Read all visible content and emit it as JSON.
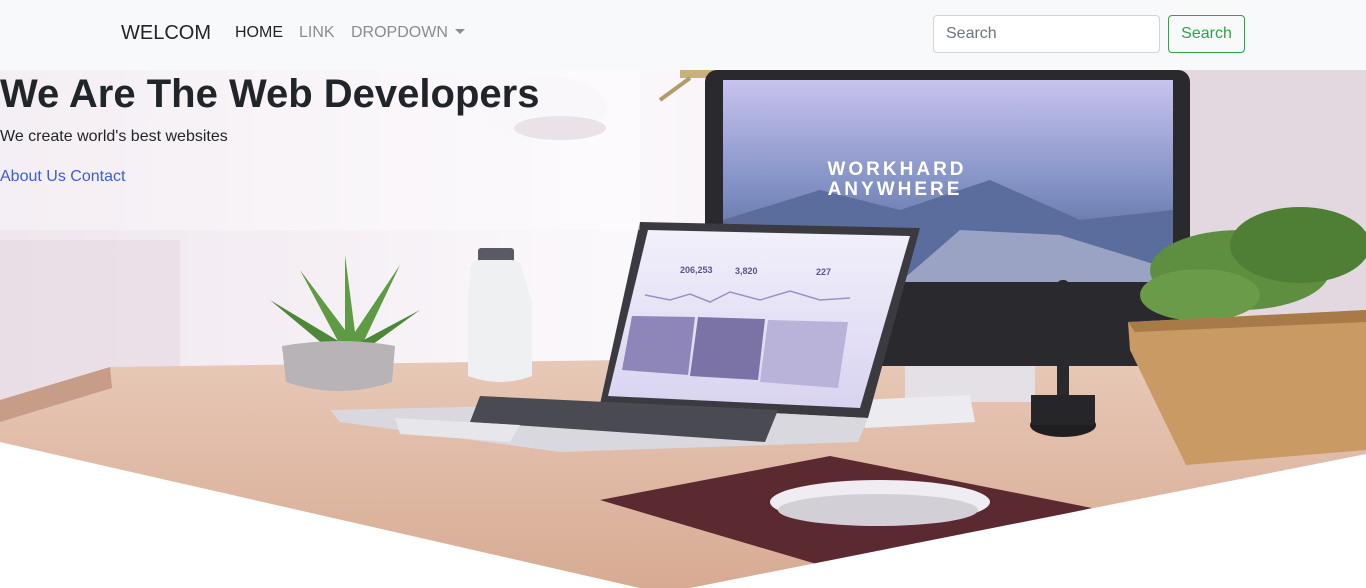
{
  "navbar": {
    "brand": "WELCOM",
    "links": [
      "HOME",
      "LINK",
      "DROPDOWN"
    ],
    "search_placeholder": "Search",
    "search_button": "Search"
  },
  "hero": {
    "title": "We Are The Web Developers",
    "subtitle": "We create world's best websites",
    "link_about": "About Us",
    "link_contact": "Contact",
    "monitor_line1": "WORKHARD",
    "monitor_line2": "ANYWHERE",
    "stats": [
      "206,253",
      "3,820",
      "227"
    ]
  },
  "colors": {
    "navbar_bg": "#f8f9fa",
    "accent_green": "#28a745",
    "link_blue": "#3d5be0"
  },
  "icons": [
    "caret-down-icon",
    "plant-icon",
    "bottle-icon",
    "lamp-icon",
    "laptop-icon",
    "monitor-icon",
    "mouse-icon",
    "pen-holder-icon"
  ]
}
